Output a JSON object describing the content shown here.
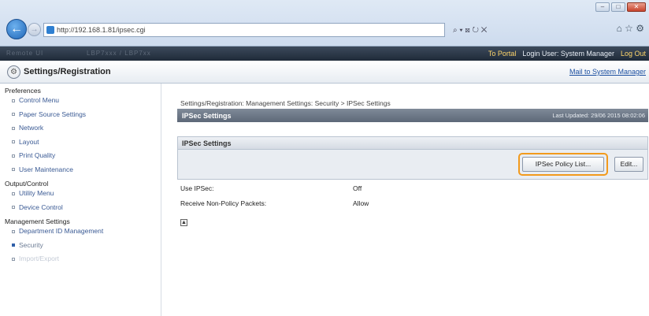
{
  "browser": {
    "url": "http://192.168.1.81/ipsec.cgi",
    "address_tools": "⌕ ▾ ⊠ ↻ ✕",
    "home_tools": "⌂ ☆ ⚙",
    "window_buttons": {
      "minimize": "–",
      "maximize": "□",
      "close": "✕"
    }
  },
  "portal_bar": {
    "brand": "Remote UI",
    "device": "LBP7xxx / LBP7xx",
    "to_portal": "To Portal",
    "login_user": "Login User: System Manager",
    "logout": "Log Out"
  },
  "header": {
    "title": "Settings/Registration",
    "mail": "Mail to System Manager"
  },
  "sidebar": {
    "sections": [
      {
        "label": "Preferences",
        "items": [
          {
            "label": "Control Menu"
          },
          {
            "label": "Paper Source Settings"
          },
          {
            "label": "Network"
          },
          {
            "label": "Layout"
          },
          {
            "label": "Print Quality"
          },
          {
            "label": "User Maintenance"
          }
        ]
      },
      {
        "label": "Output/Control",
        "items": [
          {
            "label": "Utility Menu"
          },
          {
            "label": "Device Control"
          }
        ]
      },
      {
        "label": "Management Settings",
        "items": [
          {
            "label": "Department ID Management"
          },
          {
            "label": "Security"
          },
          {
            "label": "Import/Export"
          }
        ]
      }
    ]
  },
  "main": {
    "breadcrumb": "Settings/Registration: Management Settings: Security > IPSec Settings",
    "title": "IPSec Settings",
    "last_updated": "Last Updated: 29/06 2015 08:02:06",
    "section_title": "IPSec Settings",
    "buttons": {
      "policy_list": "IPSec Policy List...",
      "edit": "Edit..."
    },
    "settings": [
      {
        "label": "Use IPSec:",
        "value": "Off"
      },
      {
        "label": "Receive Non-Policy Packets:",
        "value": "Allow"
      }
    ],
    "top_icon": "▲"
  }
}
